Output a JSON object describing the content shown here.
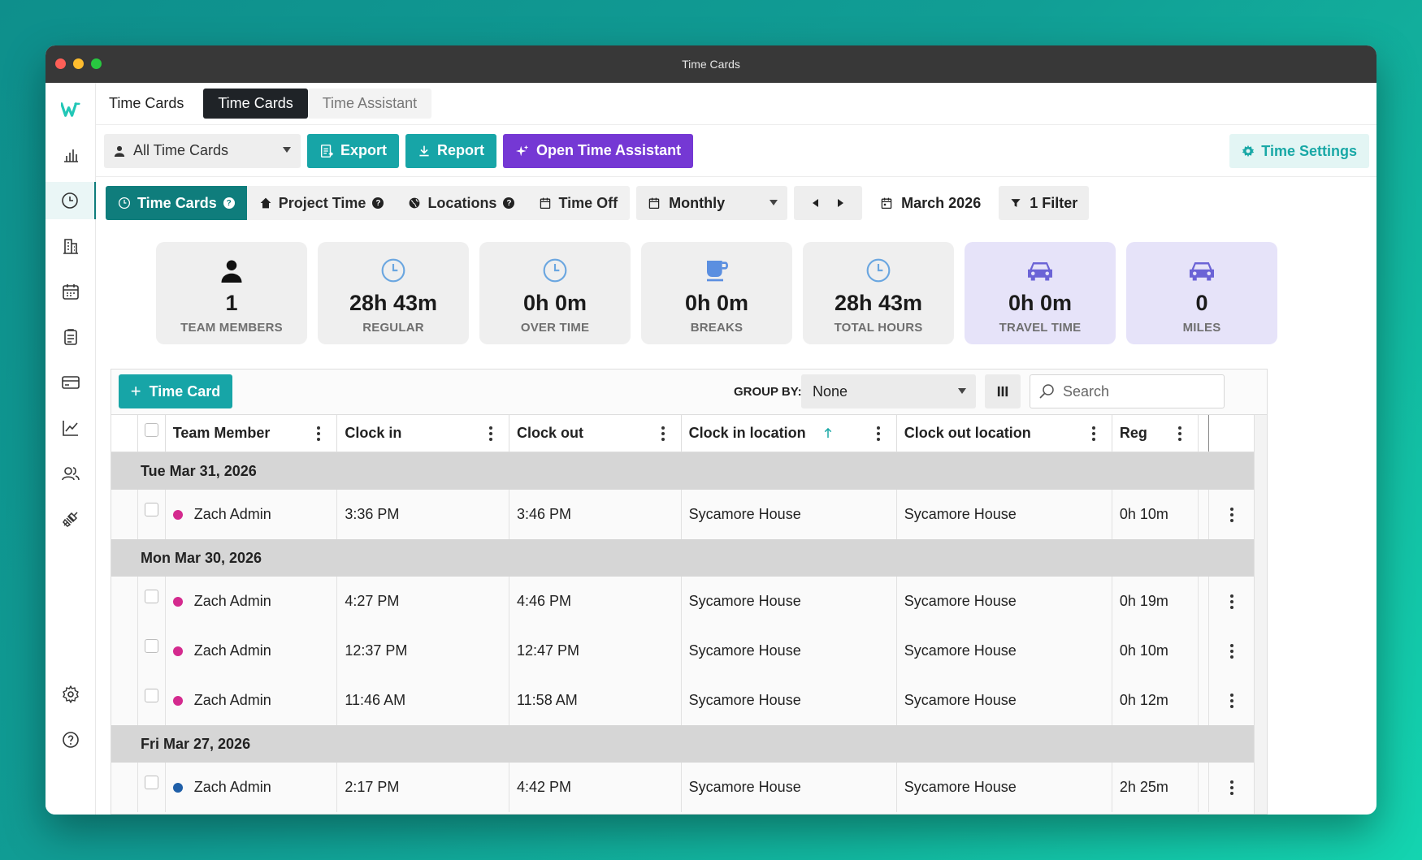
{
  "window": {
    "title": "Time Cards"
  },
  "header": {
    "section_title": "Time Cards",
    "tabs": [
      {
        "label": "Time Cards"
      },
      {
        "label": "Time Assistant"
      }
    ]
  },
  "toolbar": {
    "view_select": "All Time Cards",
    "export_label": "Export",
    "report_label": "Report",
    "assistant_label": "Open Time Assistant",
    "settings_label": "Time Settings"
  },
  "filters": {
    "segments": [
      {
        "label": "Time Cards"
      },
      {
        "label": "Project Time"
      },
      {
        "label": "Locations"
      },
      {
        "label": "Time Off"
      }
    ],
    "period": "Monthly",
    "date": "March 2026",
    "filter_label": "1 Filter"
  },
  "stats": [
    {
      "value": "1",
      "label": "TEAM MEMBERS",
      "icon": "person-icon"
    },
    {
      "value": "28h 43m",
      "label": "REGULAR",
      "icon": "clock-icon"
    },
    {
      "value": "0h 0m",
      "label": "OVER TIME",
      "icon": "clock-icon"
    },
    {
      "value": "0h 0m",
      "label": "BREAKS",
      "icon": "coffee-icon"
    },
    {
      "value": "28h 43m",
      "label": "TOTAL HOURS",
      "icon": "clock-icon"
    },
    {
      "value": "0h 0m",
      "label": "TRAVEL TIME",
      "icon": "car-icon"
    },
    {
      "value": "0",
      "label": "MILES",
      "icon": "car-icon"
    }
  ],
  "table": {
    "add_label": "Time Card",
    "group_by_label": "GROUP BY:",
    "group_by_value": "None",
    "search_placeholder": "Search",
    "columns": [
      "Team Member",
      "Clock in",
      "Clock out",
      "Clock in location",
      "Clock out location",
      "Reg"
    ],
    "groups": [
      {
        "date": "Tue Mar 31, 2026",
        "rows": [
          {
            "member": "Zach Admin",
            "clock_in": "3:36 PM",
            "clock_out": "3:46 PM",
            "in_loc": "Sycamore House",
            "out_loc": "Sycamore House",
            "reg": "0h 10m",
            "dot": "#d42a8e"
          }
        ]
      },
      {
        "date": "Mon Mar 30, 2026",
        "rows": [
          {
            "member": "Zach Admin",
            "clock_in": "4:27 PM",
            "clock_out": "4:46 PM",
            "in_loc": "Sycamore House",
            "out_loc": "Sycamore House",
            "reg": "0h 19m",
            "dot": "#d42a8e"
          },
          {
            "member": "Zach Admin",
            "clock_in": "12:37 PM",
            "clock_out": "12:47 PM",
            "in_loc": "Sycamore House",
            "out_loc": "Sycamore House",
            "reg": "0h 10m",
            "dot": "#d42a8e"
          },
          {
            "member": "Zach Admin",
            "clock_in": "11:46 AM",
            "clock_out": "11:58 AM",
            "in_loc": "Sycamore House",
            "out_loc": "Sycamore House",
            "reg": "0h 12m",
            "dot": "#d42a8e"
          }
        ]
      },
      {
        "date": "Fri Mar 27, 2026",
        "rows": [
          {
            "member": "Zach Admin",
            "clock_in": "2:17 PM",
            "clock_out": "4:42 PM",
            "in_loc": "Sycamore House",
            "out_loc": "Sycamore House",
            "reg": "2h 25m",
            "dot": "#1f5fa8"
          }
        ]
      }
    ]
  },
  "colors": {
    "teal": "#17a5a7",
    "dark_teal": "#0f7d7c",
    "purple": "#7538d4",
    "stat_icon_blue": "#6aa6e0",
    "car_icon": "#6b63d6"
  }
}
